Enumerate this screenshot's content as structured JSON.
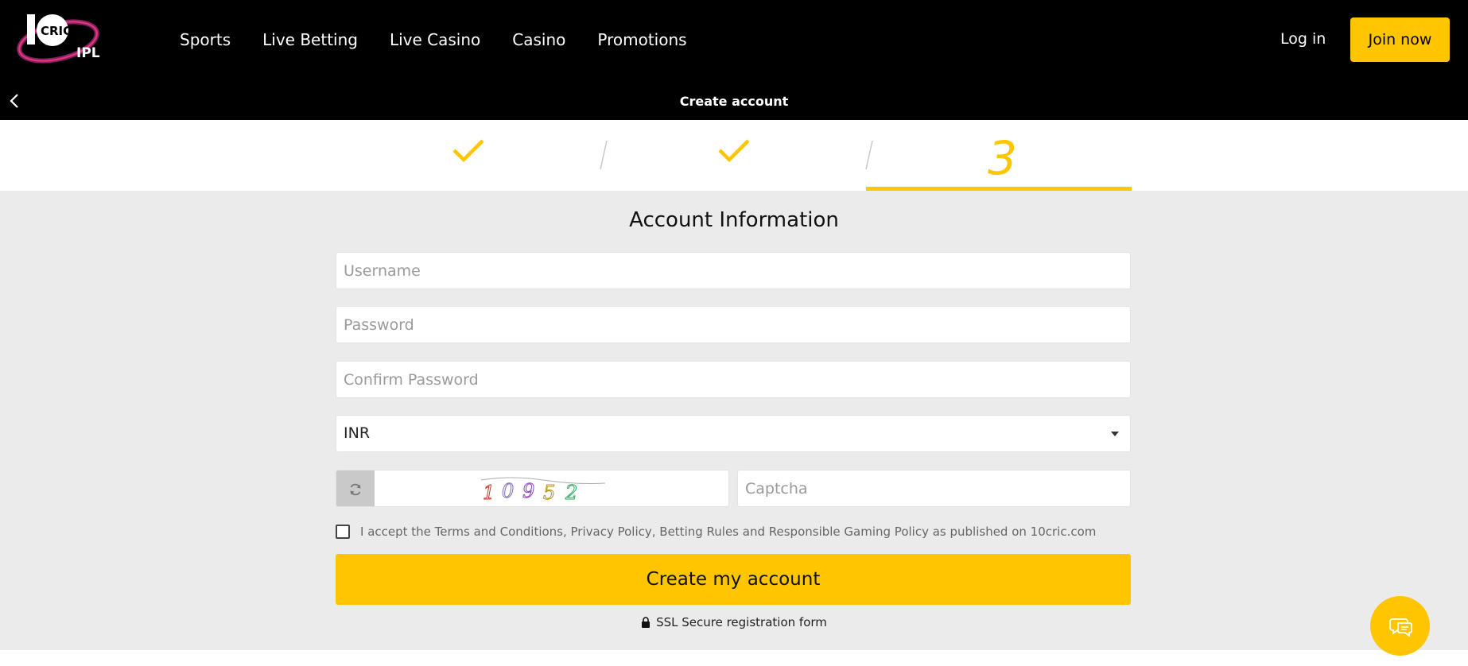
{
  "header": {
    "logo_text": "CRIC IPL",
    "nav": [
      "Sports",
      "Live Betting",
      "Live Casino",
      "Casino",
      "Promotions"
    ],
    "login_label": "Log in",
    "join_label": "Join now",
    "page_title": "Create account"
  },
  "steps": {
    "current_step": "3",
    "completed": [
      "step-1",
      "step-2"
    ]
  },
  "form": {
    "title": "Account Information",
    "username_placeholder": "Username",
    "password_placeholder": "Password",
    "confirm_placeholder": "Confirm Password",
    "currency_value": "INR",
    "captcha_code": "10952",
    "captcha_placeholder": "Captcha",
    "terms_text": "I accept the Terms and Conditions, Privacy Policy, Betting Rules and Responsible Gaming Policy as published on 10cric.com",
    "submit_label": "Create my account",
    "ssl_text": "SSL Secure registration form"
  },
  "colors": {
    "accent": "#ffc600",
    "header_bg": "#000000",
    "form_bg": "#ebebeb"
  }
}
